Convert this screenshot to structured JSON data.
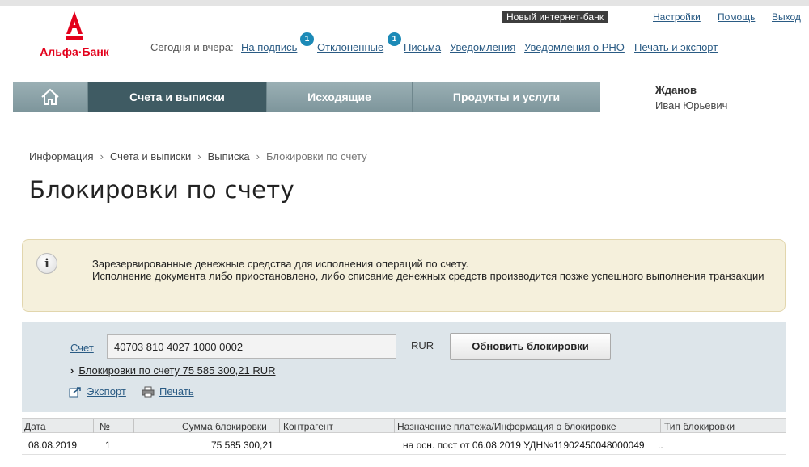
{
  "bank": {
    "name": "Альфа·Банк"
  },
  "top_links": {
    "new_bank": "Новый интернет-банк",
    "settings": "Настройки",
    "help": "Помощь",
    "logout": "Выход"
  },
  "today_nav": {
    "label": "Сегодня и вчера:",
    "links": [
      {
        "label": "На подпись",
        "badge": "1"
      },
      {
        "label": "Отклоненные",
        "badge": "1"
      },
      {
        "label": "Письма"
      },
      {
        "label": "Уведомления"
      },
      {
        "label": "Уведомления о РНО"
      },
      {
        "label": "Печать и экспорт"
      }
    ]
  },
  "main_nav": {
    "home_icon": "home-icon",
    "tabs": [
      {
        "label": "Счета и выписки",
        "active": true
      },
      {
        "label": "Исходящие",
        "active": false
      },
      {
        "label": "Продукты и услуги",
        "active": false
      }
    ]
  },
  "user": {
    "last_name": "Жданов",
    "first_name": "Иван Юрьевич"
  },
  "breadcrumb": [
    "Информация",
    "Счета и выписки",
    "Выписка",
    "Блокировки по счету"
  ],
  "page_title": "Блокировки по счету",
  "info": {
    "icon": "info-icon",
    "line1": "Зарезервированные денежные средства для исполнения операций по счету.",
    "line2": "Исполнение документа либо приостановлено, либо списание денежных средств производится позже успешного выполнения транзакции"
  },
  "controls": {
    "account_label": "Счет",
    "account_value": "40703 810 4027 1000 0002",
    "currency": "RUR",
    "refresh_button": "Обновить блокировки",
    "block_summary": "Блокировки по счету 75 585 300,21 RUR",
    "export": "Экспорт",
    "print": "Печать"
  },
  "table": {
    "columns": [
      "Дата",
      "№",
      "Сумма блокировки",
      "Контрагент",
      "Назначение платежа/Информация о блокировке",
      "Тип блокировки"
    ],
    "rows": [
      [
        "08.08.2019",
        "1",
        "75 585 300,21",
        "",
        "на осн. пост от 06.08.2019 УДН№11902450048000049",
        ".."
      ]
    ]
  },
  "colors": {
    "brand_red": "#e3001b",
    "link_blue": "#2a5b84",
    "nav_active": "#3f5b63",
    "nav_bg": "#8aa1a7",
    "badge": "#1c8ab7",
    "info_bg": "#f5f0dc",
    "panel_bg": "#dde5ea"
  }
}
